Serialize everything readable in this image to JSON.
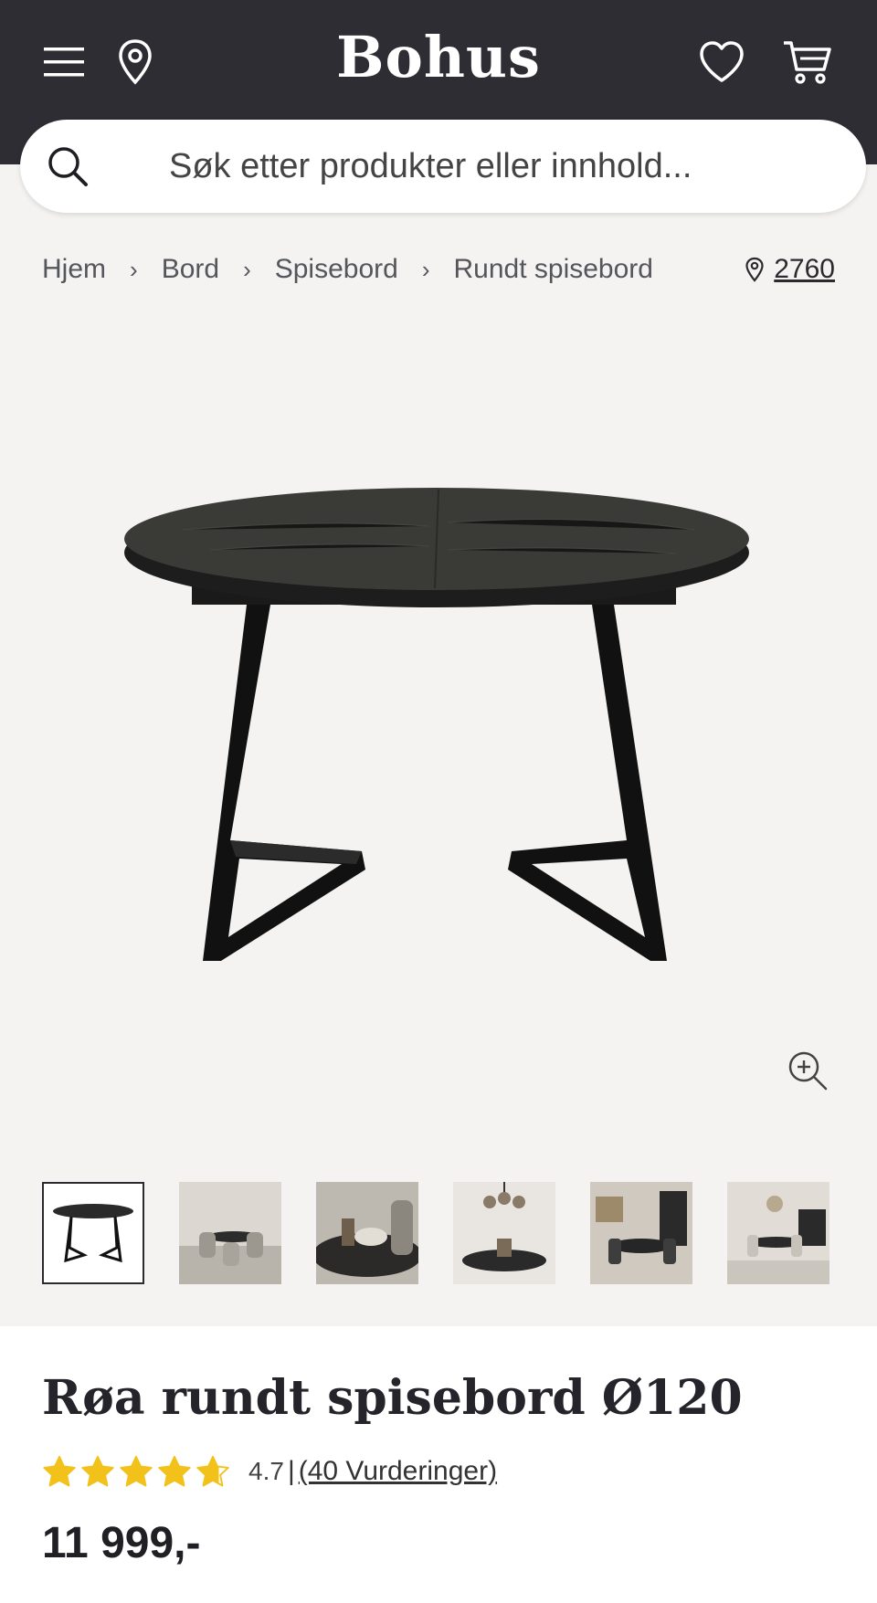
{
  "header": {
    "brand": "Bohus",
    "menu_icon": "hamburger-menu-icon",
    "location_icon": "map-pin-icon",
    "wishlist_icon": "heart-icon",
    "cart_icon": "shopping-cart-icon",
    "background": "#2e2d33"
  },
  "search": {
    "placeholder": "Søk etter produkter eller innhold...",
    "icon": "search-icon"
  },
  "breadcrumb": {
    "items": [
      "Hjem",
      "Bord",
      "Spisebord",
      "Rundt spisebord"
    ],
    "separator": ">"
  },
  "location": {
    "postcode": "2760"
  },
  "gallery": {
    "zoom_icon": "zoom-in-icon",
    "thumbnail_count": 6,
    "active_index": 0
  },
  "product": {
    "title": "Røa rundt spisebord Ø120",
    "rating_value": "4.7",
    "rating_sep": "|",
    "reviews_label": "(40 Vurderinger)",
    "stars": 4.7,
    "star_color": "#f2c21b",
    "price": "11 999,-"
  }
}
